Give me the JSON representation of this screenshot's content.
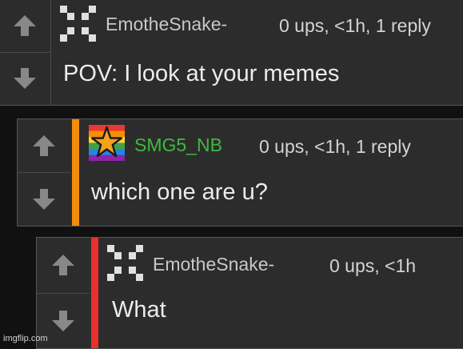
{
  "comments": [
    {
      "username": "EmotheSnake-",
      "username_color": "#c8c8c8",
      "meta": "0 ups, <1h, 1 reply",
      "text": "POV: I look at your memes",
      "avatar": "pixel-x-avatar",
      "accent_color": null
    },
    {
      "username": "SMG5_NB",
      "username_color": "#3fba3f",
      "meta": "0 ups, <1h, 1 reply",
      "text": "which one are u?",
      "avatar": "rainbow-star-avatar",
      "accent_color": "#f38b0c"
    },
    {
      "username": "EmotheSnake-",
      "username_color": "#c8c8c8",
      "meta": "0 ups, <1h",
      "text": "What",
      "avatar": "pixel-x-avatar",
      "accent_color": "#e8302c"
    }
  ],
  "icons": {
    "upvote": "up-arrow-icon",
    "downvote": "down-arrow-icon"
  },
  "colors": {
    "background": "#111111",
    "panel": "#2c2c2c",
    "arrow": "#888888"
  },
  "watermark": "imgflip.com"
}
